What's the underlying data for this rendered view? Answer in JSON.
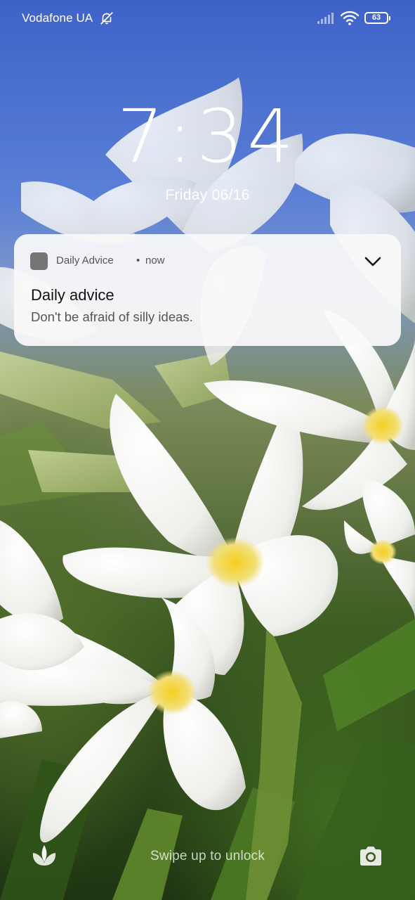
{
  "status_bar": {
    "carrier": "Vodafone UA",
    "battery_level": "63",
    "icons": [
      "bell-off-icon",
      "signal-icon",
      "wifi-icon",
      "battery-icon"
    ]
  },
  "lock_screen": {
    "time": "7:34",
    "date": "Friday 06/16",
    "swipe_hint": "Swipe up to unlock",
    "shortcuts": [
      "flower-icon",
      "camera-icon"
    ]
  },
  "notification": {
    "app_name": "Daily Advice",
    "separator": "•",
    "time": "now",
    "title": "Daily advice",
    "body": "Don't be afraid of silly ideas.",
    "app_icon_color": "#757575",
    "expand_icon": "chevron-down-icon"
  },
  "colors": {
    "sky": "#3e62c8",
    "foliage": "#3d5a22",
    "petal": "#f7f7f2",
    "flower_center": "#f2d13a",
    "notification_bg": "#fafafa"
  }
}
